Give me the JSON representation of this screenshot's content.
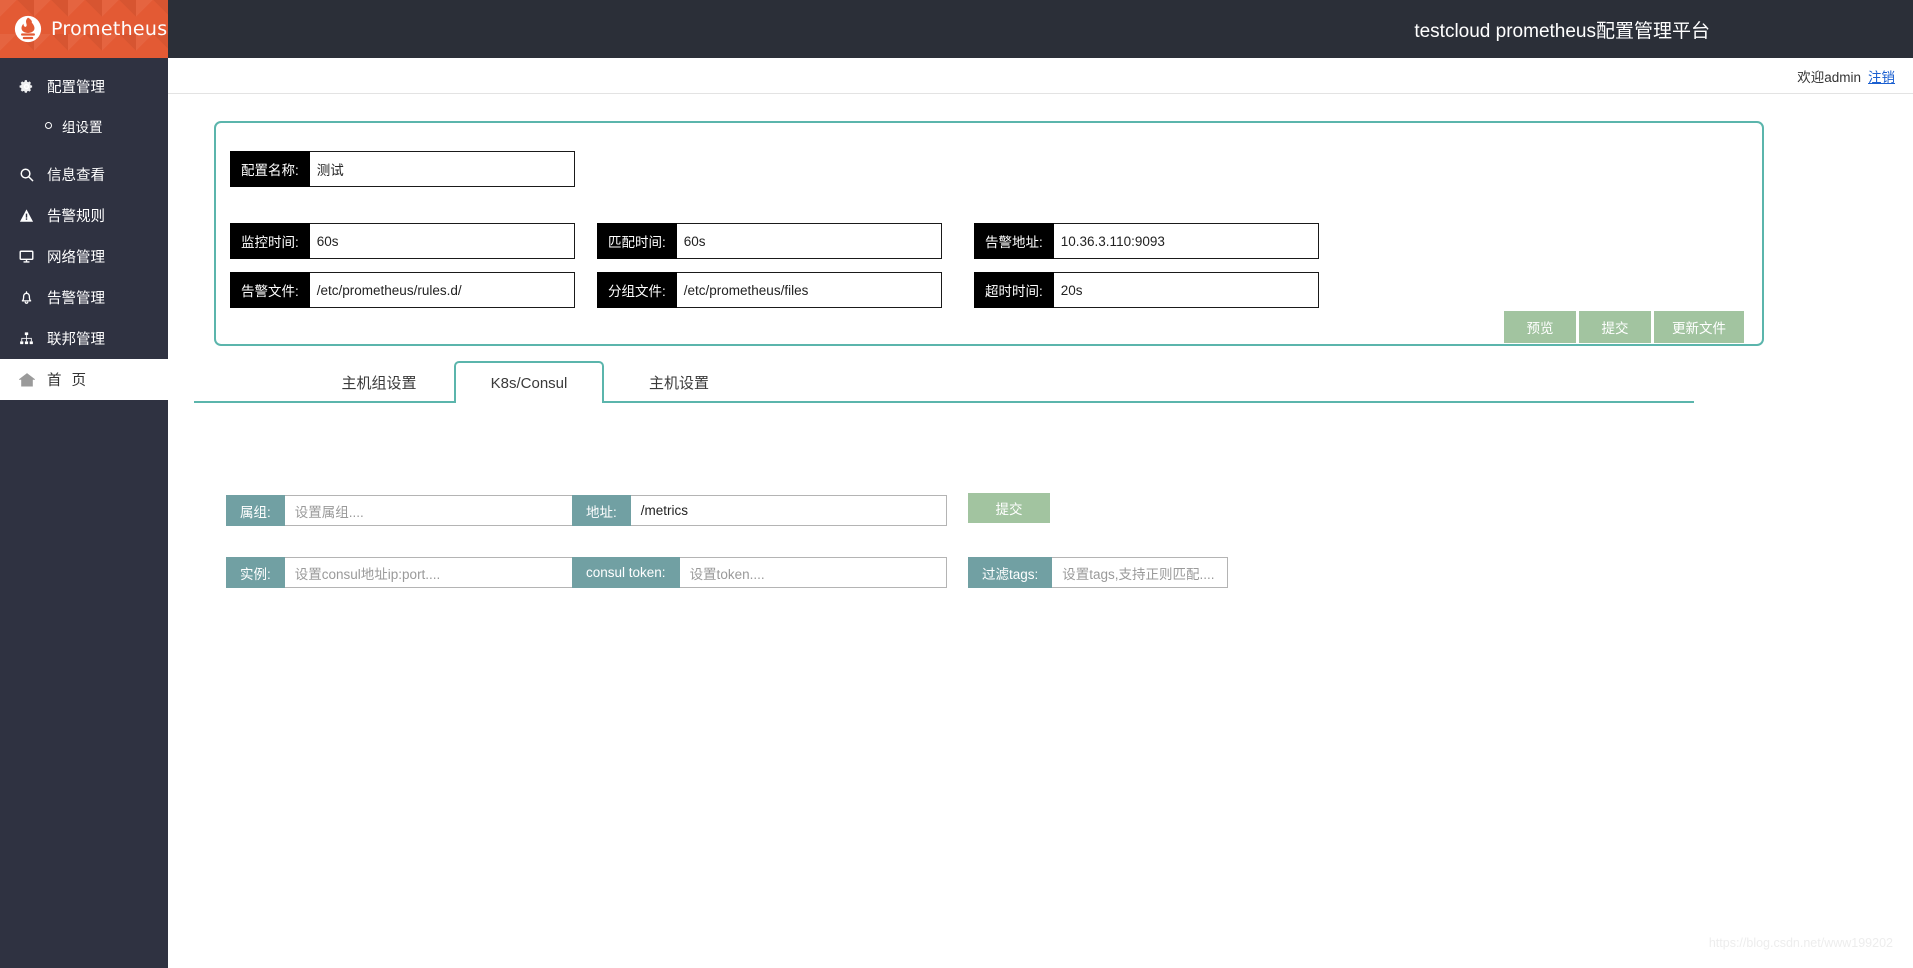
{
  "brand": {
    "name": "Prometheus",
    "logo_icon": "prometheus-torch-icon"
  },
  "sidebar": {
    "items": [
      {
        "label": "配置管理",
        "icon": "gear-icon",
        "type": "item",
        "active": false
      },
      {
        "label": "组设置",
        "icon": "circle-dot-icon",
        "type": "sub",
        "active": false
      },
      {
        "label": "信息查看",
        "icon": "search-icon",
        "type": "item",
        "active": false
      },
      {
        "label": "告警规则",
        "icon": "warning-triangle-icon",
        "type": "item",
        "active": false
      },
      {
        "label": "网络管理",
        "icon": "monitor-icon",
        "type": "item",
        "active": false
      },
      {
        "label": "告警管理",
        "icon": "bell-icon",
        "type": "item",
        "active": false
      },
      {
        "label": "联邦管理",
        "icon": "sitemap-icon",
        "type": "item",
        "active": false
      },
      {
        "label": "首 页",
        "icon": "home-icon",
        "type": "item",
        "active": true
      }
    ]
  },
  "header": {
    "title": "testcloud prometheus配置管理平台",
    "welcome": "欢迎admin",
    "logout_label": "注销"
  },
  "config_panel": {
    "fields": {
      "config_name": {
        "label": "配置名称:",
        "value": "测试"
      },
      "monitor_time": {
        "label": "监控时间:",
        "value": "60s"
      },
      "match_time": {
        "label": "匹配时间:",
        "value": "60s"
      },
      "alert_address": {
        "label": "告警地址:",
        "value": "10.36.3.110:9093"
      },
      "alert_file": {
        "label": "告警文件:",
        "value": "/etc/prometheus/rules.d/"
      },
      "group_file": {
        "label": "分组文件:",
        "value": "/etc/prometheus/files"
      },
      "timeout": {
        "label": "超时时间:",
        "value": "20s"
      }
    },
    "buttons": {
      "preview": "预览",
      "submit": "提交",
      "update_file": "更新文件"
    }
  },
  "tabs": [
    {
      "label": "主机组设置",
      "active": false
    },
    {
      "label": "K8s/Consul",
      "active": true
    },
    {
      "label": "主机设置",
      "active": false
    }
  ],
  "k8s_consul_form": {
    "fields": {
      "group": {
        "label": "属组:",
        "value": "",
        "placeholder": "设置属组...."
      },
      "address": {
        "label": "地址:",
        "value": "/metrics",
        "placeholder": ""
      },
      "instance": {
        "label": "实例:",
        "value": "",
        "placeholder": "设置consul地址ip:port...."
      },
      "consul_token": {
        "label": "consul token:",
        "value": "",
        "placeholder": "设置token...."
      },
      "filter_tags": {
        "label": "过滤tags:",
        "value": "",
        "placeholder": "设置tags,支持正则匹配...."
      }
    },
    "submit_label": "提交"
  },
  "watermark": "https://blog.csdn.net/www199202",
  "colors": {
    "brand_orange": "#e35a34",
    "sidebar_dark": "#2f3241",
    "topbar_dark": "#2b2f38",
    "teal_accent": "#5bb5ac",
    "teal_label": "#71a0a3",
    "green_button": "#a2c4a0",
    "link_blue": "#1a5fd0"
  }
}
